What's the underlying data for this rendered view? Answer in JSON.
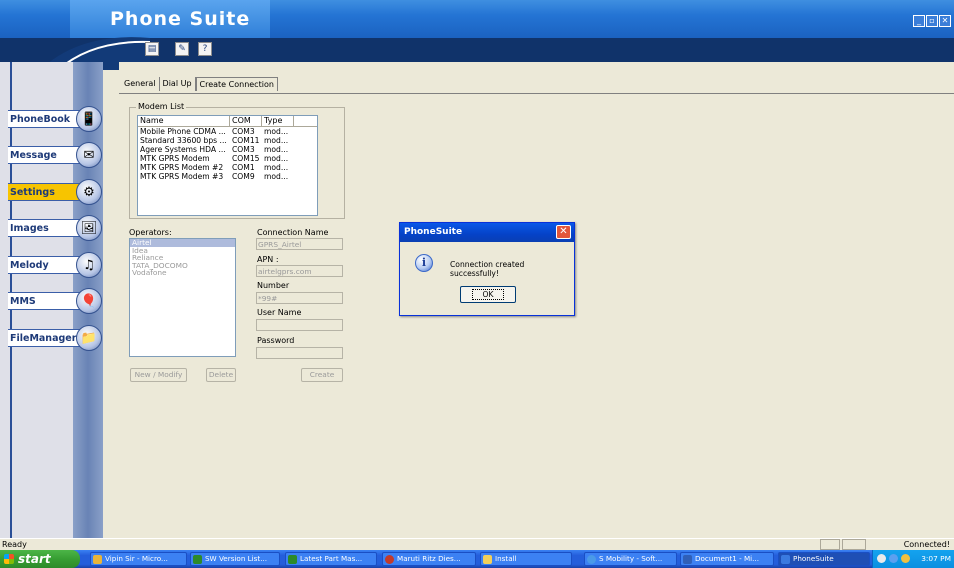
{
  "window": {
    "title": "Phone Suite",
    "controls": [
      "_",
      "▫",
      "✕"
    ]
  },
  "toolbar": {
    "buttons": [
      "notes",
      "edit",
      "help"
    ],
    "help_label": "?"
  },
  "sidebar": {
    "items": [
      {
        "label": "PhoneBook",
        "icon": "phone-icon",
        "active": false
      },
      {
        "label": "Message",
        "icon": "envelope-icon",
        "active": false
      },
      {
        "label": "Settings",
        "icon": "phone-settings-icon",
        "active": true
      },
      {
        "label": "Images",
        "icon": "picture-icon",
        "active": false
      },
      {
        "label": "Melody",
        "icon": "music-icon",
        "active": false
      },
      {
        "label": "MMS",
        "icon": "balloon-icon",
        "active": false
      },
      {
        "label": "FileManager",
        "icon": "folder-icon",
        "active": false
      }
    ]
  },
  "tabs": [
    {
      "label": "General",
      "active": false
    },
    {
      "label": "Dial Up",
      "active": false
    },
    {
      "label": "Create Connection",
      "active": true
    }
  ],
  "modem_list": {
    "legend": "Modem List",
    "columns": [
      "Name",
      "COM",
      "Type"
    ],
    "rows": [
      [
        "Mobile Phone CDMA ...",
        "COM3",
        "mod..."
      ],
      [
        "Standard 33600 bps ...",
        "COM11",
        "mod..."
      ],
      [
        "Agere Systems HDA ...",
        "COM3",
        "mod..."
      ],
      [
        "MTK GPRS Modem",
        "COM15",
        "mod..."
      ],
      [
        "MTK GPRS Modem #2",
        "COM1",
        "mod..."
      ],
      [
        "MTK GPRS Modem #3",
        "COM9",
        "mod..."
      ]
    ]
  },
  "operators": {
    "label": "Operators:",
    "items": [
      "Airtel",
      "Idea",
      "Reliance",
      "TATA_DOCOMO",
      "Vodafone"
    ],
    "selected": "Airtel"
  },
  "form": {
    "connection_name_label": "Connection Name",
    "connection_name_value": "GPRS_Airtel",
    "apn_label": "APN :",
    "apn_value": "airtelgprs.com",
    "number_label": "Number",
    "number_value": "*99#",
    "username_label": "User Name",
    "username_value": "",
    "password_label": "Password",
    "password_value": ""
  },
  "buttons": {
    "new_modify": "New / Modify",
    "delete": "Delete",
    "create": "Create"
  },
  "dialog": {
    "title": "PhoneSuite",
    "close": "✕",
    "icon": "info-icon",
    "message": "Connection created successfully!",
    "ok": "OK"
  },
  "status": {
    "left": "Ready",
    "right": "Connected!"
  },
  "taskbar": {
    "start": "start",
    "tasks": [
      {
        "label": "Vipin Sir - Micro...",
        "icon_color": "#e8b43a"
      },
      {
        "label": "SW Version List...",
        "icon_color": "#2d8a2a"
      },
      {
        "label": "Latest Part Mas...",
        "icon_color": "#2d8a2a"
      },
      {
        "label": "Maruti Ritz Dies...",
        "icon_color": "#c33a2a"
      },
      {
        "label": "Install",
        "icon_color": "#f2cf5a"
      },
      {
        "label": "S Mobility - Soft...",
        "icon_color": "#4a9ae8"
      },
      {
        "label": "Document1 - Mi...",
        "icon_color": "#2f5fb8"
      },
      {
        "label": "PhoneSuite",
        "icon_color": "#3a7ae0",
        "active": true
      }
    ],
    "clock": "3:07 PM"
  }
}
